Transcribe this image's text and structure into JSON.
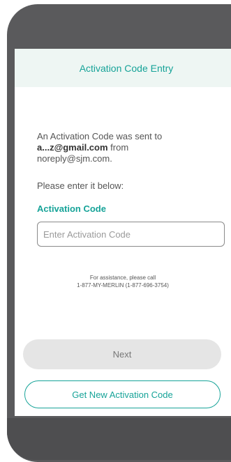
{
  "header": {
    "title": "Activation Code Entry"
  },
  "message": {
    "line1": "An Activation Code was sent to",
    "email": "a...z@gmail.com",
    "from_text": "from",
    "sender": "noreply@sjm.com."
  },
  "prompt": "Please enter it below:",
  "activation_field": {
    "label": "Activation Code",
    "placeholder": "Enter Activation Code",
    "value": ""
  },
  "assistance": {
    "line1": "For assistance, please call",
    "line2": "1-877-MY-MERLIN (1-877-696-3754)"
  },
  "buttons": {
    "next": "Next",
    "get_new_code": "Get New Activation Code"
  },
  "colors": {
    "accent": "#16a398",
    "header_bg": "#eef6f3",
    "disabled_button": "#e5e5e5",
    "device_frame": "#5a5a5c"
  }
}
